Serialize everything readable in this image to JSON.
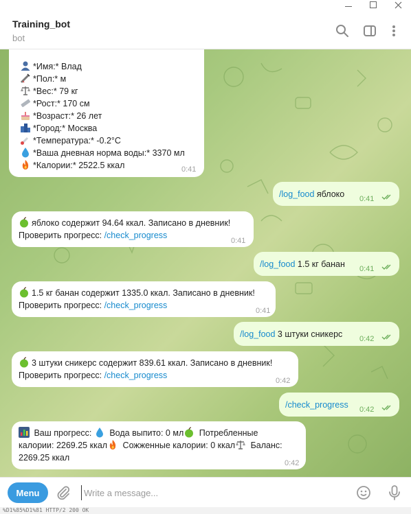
{
  "header": {
    "title": "Training_bot",
    "subtitle": "bot"
  },
  "profile": {
    "lines": [
      {
        "emoji": "person",
        "text": "*Имя:* Влад"
      },
      {
        "emoji": "syringe",
        "text": "*Пол:* м"
      },
      {
        "emoji": "scales",
        "text": "*Вес:* 79 кг"
      },
      {
        "emoji": "ruler",
        "text": "*Рост:* 170 см"
      },
      {
        "emoji": "cake",
        "text": "*Возраст:* 26 лет"
      },
      {
        "emoji": "city",
        "text": "*Город:* Москва"
      },
      {
        "emoji": "thermometer",
        "text": "*Температура:* -0.2°C"
      },
      {
        "emoji": "droplet",
        "text": "*Ваша дневная норма воды:* 3370 мл"
      },
      {
        "emoji": "fire",
        "text": "*Калории:* 2522.5 ккал"
      }
    ],
    "time": "0:41"
  },
  "messages": [
    {
      "cmd": "/log_food",
      "text": " яблоко",
      "time": "0:41"
    },
    {
      "line1": "яблоко содержит 94.64 ккал. Записано в дневник!",
      "prefix": "Проверить прогресс: ",
      "link": "/check_progress",
      "time": "0:41"
    },
    {
      "cmd": "/log_food",
      "text": " 1.5 кг банан",
      "time": "0:41"
    },
    {
      "line1": "1.5 кг банан содержит 1335.0 ккал. Записано в дневник!",
      "prefix": "Проверить прогресс: ",
      "link": "/check_progress",
      "time": "0:41"
    },
    {
      "cmd": "/log_food",
      "text": " 3 штуки сникерс",
      "time": "0:42"
    },
    {
      "line1": "3 штуки сникерс содержит 839.61 ккал. Записано в дневник!",
      "prefix": "Проверить прогресс: ",
      "link": "/check_progress",
      "time": "0:42"
    },
    {
      "cmd": "/check_progress",
      "text": "",
      "time": "0:42"
    }
  ],
  "progress": {
    "part1": " Ваш прогресс: ",
    "part2": " Вода выпито: 0 мл",
    "part3": " Потребленные",
    "part4": "калории: 2269.25 ккал",
    "part5": " Сожженные калории: 0 ккал",
    "part6": " Баланс:",
    "part7": "2269.25 ккал",
    "time": "0:42"
  },
  "input": {
    "menu_label": "Menu",
    "placeholder": "Write a message..."
  },
  "status_text": "%D1%85%D1%81   HTTP/2 200 OK",
  "colors": {
    "accent": "#3a9be0",
    "link": "#168acd",
    "outgoing_bubble": "#effdde",
    "check": "#6cae5b"
  }
}
